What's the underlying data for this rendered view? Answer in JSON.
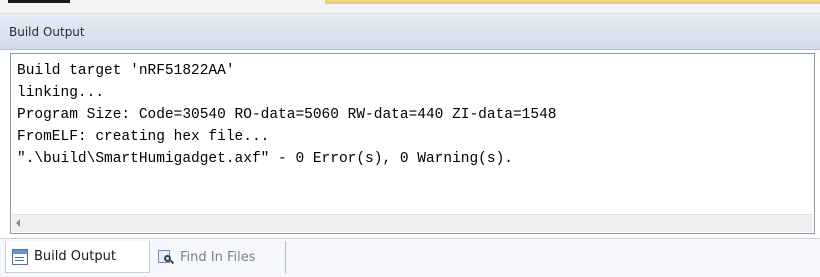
{
  "pane": {
    "title": "Build Output"
  },
  "output": {
    "lines": [
      "Build target 'nRF51822AA'",
      "linking...",
      "Program Size: Code=30540 RO-data=5060 RW-data=440 ZI-data=1548",
      "FromELF: creating hex file...",
      "\".\\build\\SmartHumigadget.axf\" - 0 Error(s), 0 Warning(s)."
    ]
  },
  "tabs": [
    {
      "label": "Build Output",
      "icon": "build-output-icon",
      "active": true
    },
    {
      "label": "Find In Files",
      "icon": "find-in-files-icon",
      "active": false
    }
  ],
  "colors": {
    "title_bar": "#dbe3ee",
    "output_border": "#8d9aaa",
    "tab_strip": "#f5f7fa",
    "editor_tab_accent": "#e9c46b"
  }
}
